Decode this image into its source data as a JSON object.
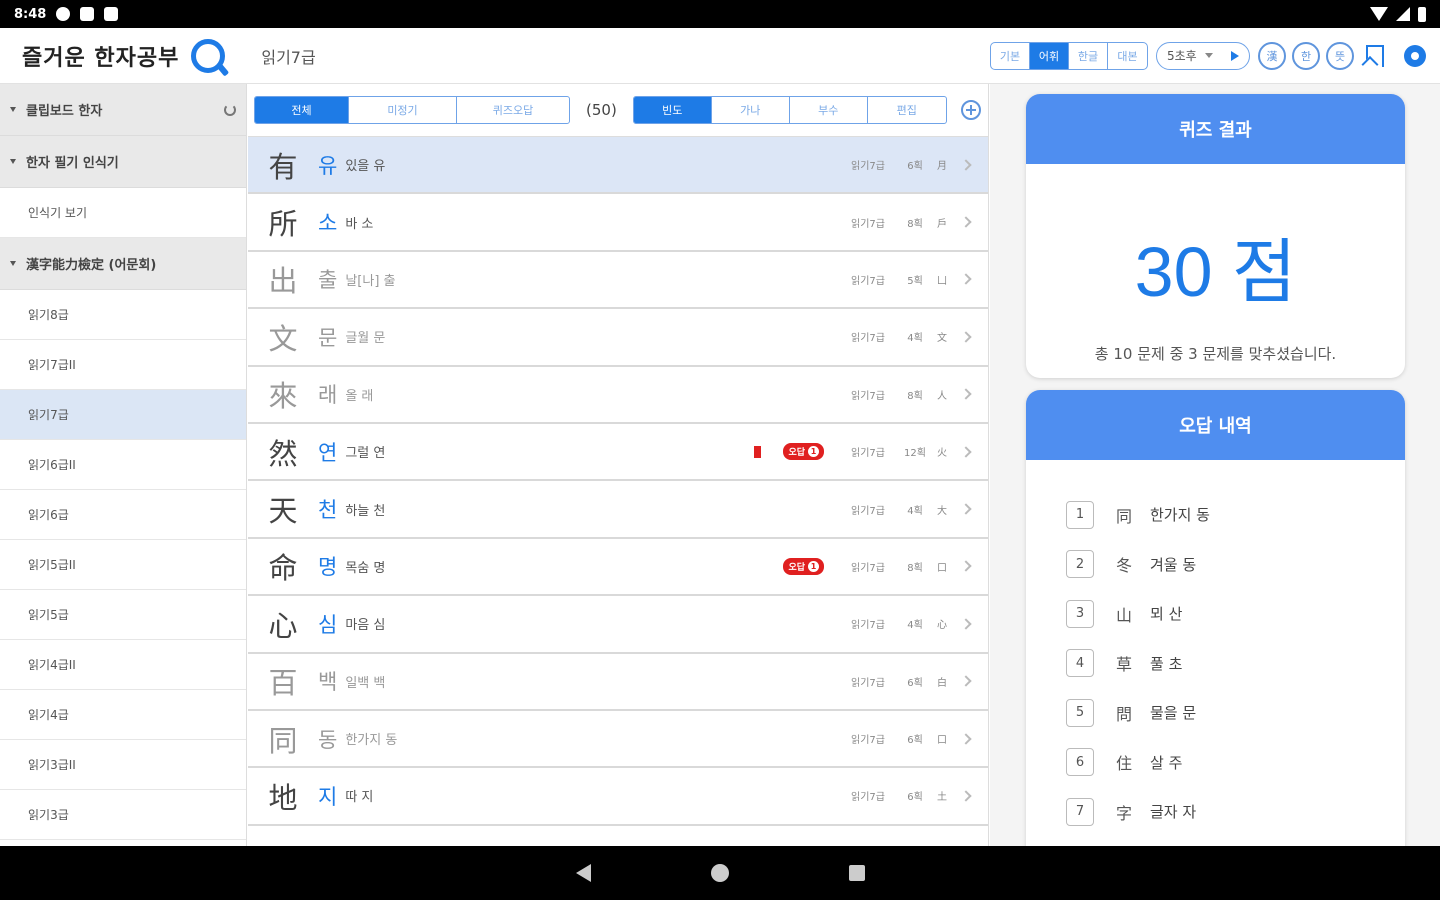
{
  "status": {
    "time": "8:48"
  },
  "app": {
    "title": "즐거운 한자공부",
    "breadcrumb": "읽기7급",
    "mode_tabs": [
      {
        "label": "기본",
        "on": false
      },
      {
        "label": "어휘",
        "on": true
      },
      {
        "label": "한글",
        "on": false
      },
      {
        "label": "대본",
        "on": false
      }
    ],
    "time_select": "5초후",
    "circle_buttons": [
      "漢",
      "한",
      "뜻"
    ]
  },
  "sidebar": {
    "groups": [
      {
        "label": "클립보드 한자",
        "has_refresh": true,
        "items": []
      },
      {
        "label": "한자 필기 인식기",
        "has_refresh": false,
        "items": [
          {
            "label": "인식기 보기",
            "selected": false
          }
        ]
      },
      {
        "label": "漢字能力檢定 (어문회)",
        "has_refresh": false,
        "items": [
          {
            "label": "읽기8급",
            "selected": false
          },
          {
            "label": "읽기7급II",
            "selected": false
          },
          {
            "label": "읽기7급",
            "selected": true
          },
          {
            "label": "읽기6급II",
            "selected": false
          },
          {
            "label": "읽기6급",
            "selected": false
          },
          {
            "label": "읽기5급II",
            "selected": false
          },
          {
            "label": "읽기5급",
            "selected": false
          },
          {
            "label": "읽기4급II",
            "selected": false
          },
          {
            "label": "읽기4급",
            "selected": false
          },
          {
            "label": "읽기3급II",
            "selected": false
          },
          {
            "label": "읽기3급",
            "selected": false
          }
        ]
      }
    ]
  },
  "filters": {
    "scope": [
      {
        "label": "전체",
        "on": true
      },
      {
        "label": "미정기",
        "on": false
      },
      {
        "label": "퀴즈오답",
        "on": false
      }
    ],
    "count": "(50)",
    "sort": [
      {
        "label": "빈도",
        "on": true
      },
      {
        "label": "가나",
        "on": false
      },
      {
        "label": "부수",
        "on": false
      },
      {
        "label": "편집",
        "on": false
      }
    ]
  },
  "hanja_list": [
    {
      "hanja": "有",
      "reading": "유",
      "meaning": "있을 유",
      "level": "읽기7급",
      "strokes": "6획",
      "radical": "月",
      "selected": true,
      "dim": false,
      "bookmark": false,
      "badge": ""
    },
    {
      "hanja": "所",
      "reading": "소",
      "meaning": "바 소",
      "level": "읽기7급",
      "strokes": "8획",
      "radical": "戶",
      "selected": false,
      "dim": false,
      "bookmark": false,
      "badge": ""
    },
    {
      "hanja": "出",
      "reading": "출",
      "meaning": "날[나] 출",
      "level": "읽기7급",
      "strokes": "5획",
      "radical": "凵",
      "selected": false,
      "dim": true,
      "bookmark": false,
      "badge": ""
    },
    {
      "hanja": "文",
      "reading": "문",
      "meaning": "글월 문",
      "level": "읽기7급",
      "strokes": "4획",
      "radical": "文",
      "selected": false,
      "dim": true,
      "bookmark": false,
      "badge": ""
    },
    {
      "hanja": "來",
      "reading": "래",
      "meaning": "올 래",
      "level": "읽기7급",
      "strokes": "8획",
      "radical": "人",
      "selected": false,
      "dim": true,
      "bookmark": false,
      "badge": ""
    },
    {
      "hanja": "然",
      "reading": "연",
      "meaning": "그럴 연",
      "level": "읽기7급",
      "strokes": "12획",
      "radical": "火",
      "selected": false,
      "dim": false,
      "bookmark": true,
      "badge": "오답",
      "badge_num": "1"
    },
    {
      "hanja": "天",
      "reading": "천",
      "meaning": "하늘 천",
      "level": "읽기7급",
      "strokes": "4획",
      "radical": "大",
      "selected": false,
      "dim": false,
      "bookmark": false,
      "badge": ""
    },
    {
      "hanja": "命",
      "reading": "명",
      "meaning": "목숨 명",
      "level": "읽기7급",
      "strokes": "8획",
      "radical": "口",
      "selected": false,
      "dim": false,
      "bookmark": false,
      "badge": "오답",
      "badge_num": "1"
    },
    {
      "hanja": "心",
      "reading": "심",
      "meaning": "마음 심",
      "level": "읽기7급",
      "strokes": "4획",
      "radical": "心",
      "selected": false,
      "dim": false,
      "bookmark": false,
      "badge": ""
    },
    {
      "hanja": "百",
      "reading": "백",
      "meaning": "일백 백",
      "level": "읽기7급",
      "strokes": "6획",
      "radical": "白",
      "selected": false,
      "dim": true,
      "bookmark": false,
      "badge": ""
    },
    {
      "hanja": "同",
      "reading": "동",
      "meaning": "한가지 동",
      "level": "읽기7급",
      "strokes": "6획",
      "radical": "口",
      "selected": false,
      "dim": true,
      "bookmark": false,
      "badge": ""
    },
    {
      "hanja": "地",
      "reading": "지",
      "meaning": "따 지",
      "level": "읽기7급",
      "strokes": "6획",
      "radical": "土",
      "selected": false,
      "dim": false,
      "bookmark": false,
      "badge": ""
    }
  ],
  "quiz_result": {
    "title": "퀴즈 결과",
    "score": "30 점",
    "description": "총 10 문제 중 3 문제를 맞추셨습니다."
  },
  "wrong_answers": {
    "title": "오답 내역",
    "items": [
      {
        "num": "1",
        "hanja": "同",
        "meaning": "한가지 동"
      },
      {
        "num": "2",
        "hanja": "冬",
        "meaning": "겨울 동"
      },
      {
        "num": "3",
        "hanja": "山",
        "meaning": "뫼 산"
      },
      {
        "num": "4",
        "hanja": "草",
        "meaning": "풀 초"
      },
      {
        "num": "5",
        "hanja": "問",
        "meaning": "물을 문"
      },
      {
        "num": "6",
        "hanja": "住",
        "meaning": "살 주"
      },
      {
        "num": "7",
        "hanja": "字",
        "meaning": "글자 자"
      }
    ]
  }
}
